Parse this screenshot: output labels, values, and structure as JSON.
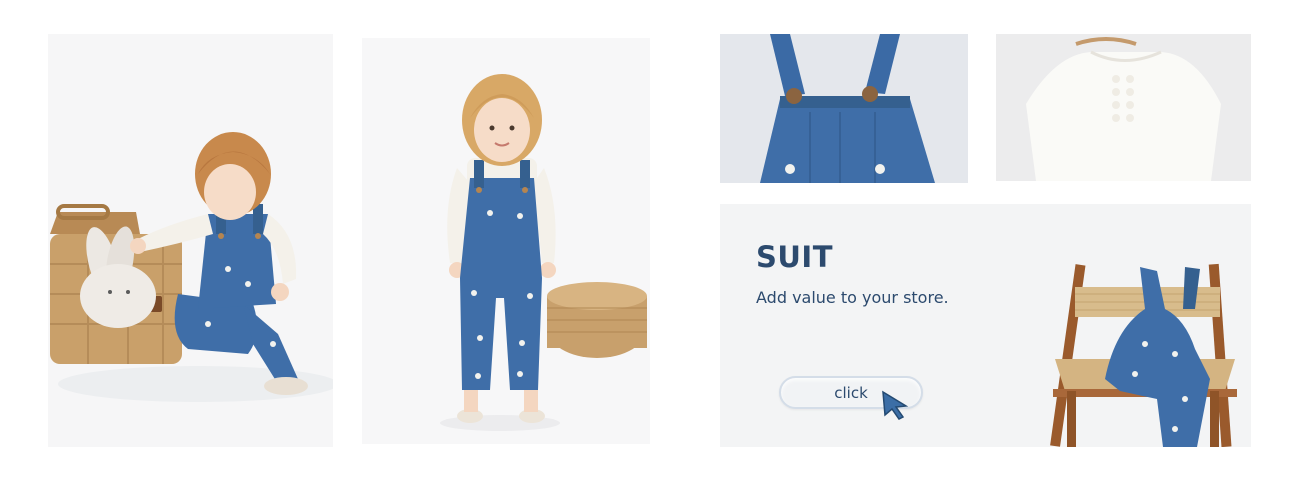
{
  "gallery": {
    "photos": [
      {
        "name": "child-sitting-with-bunny-basket"
      },
      {
        "name": "child-standing-overalls"
      },
      {
        "name": "overall-straps-closeup"
      },
      {
        "name": "white-blouse-on-hanger"
      }
    ]
  },
  "promo": {
    "title": "SUIT",
    "subtitle": "Add value to your store.",
    "button_label": "click"
  },
  "colors": {
    "brand_text": "#2c4a6e",
    "denim": "#3f6ea8",
    "card_bg": "#f3f4f5"
  },
  "icons": {
    "cursor": "arrow-cursor-icon"
  }
}
